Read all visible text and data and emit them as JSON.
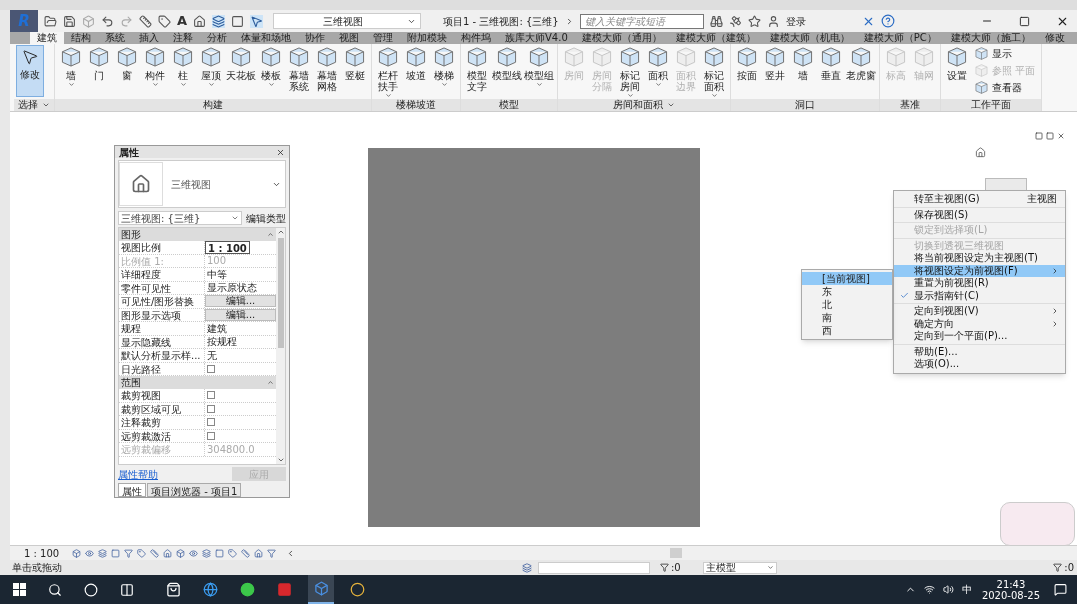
{
  "app": {
    "logo": "R",
    "text_tool": "A",
    "view_selector": "三维视图",
    "title": "项目1 - 三维视图: {三维}",
    "search": {
      "placeholder": "键入关键字或短语"
    },
    "sign_in": "登录"
  },
  "ribbon_tabs": [
    {
      "label": "建筑",
      "selected": true
    },
    {
      "label": "结构",
      "selected": false
    },
    {
      "label": "系统",
      "selected": false
    },
    {
      "label": "插入",
      "selected": false
    },
    {
      "label": "注释",
      "selected": false
    },
    {
      "label": "分析",
      "selected": false
    },
    {
      "label": "体量和场地",
      "selected": false
    },
    {
      "label": "协作",
      "selected": false
    },
    {
      "label": "视图",
      "selected": false
    },
    {
      "label": "管理",
      "selected": false
    },
    {
      "label": "附加模块",
      "selected": false
    },
    {
      "label": "构件坞",
      "selected": false
    },
    {
      "label": "族库大师V4.0",
      "selected": false
    },
    {
      "label": "建模大师（通用）",
      "selected": false
    },
    {
      "label": "建模大师（建筑）",
      "selected": false
    },
    {
      "label": "建模大师（机电）",
      "selected": false
    },
    {
      "label": "建模大师（PC）",
      "selected": false
    },
    {
      "label": "建模大师（施工）",
      "selected": false
    },
    {
      "label": "修改",
      "selected": false
    }
  ],
  "ribbon_panels": [
    {
      "title": "选择",
      "has_menu": true,
      "tools": [
        {
          "label": "修改",
          "kind": "large",
          "menu": false,
          "disabled": false,
          "selected": true
        }
      ]
    },
    {
      "title": "构建",
      "has_menu": false,
      "tools": [
        {
          "label": "墙",
          "kind": "large",
          "menu": true,
          "disabled": false,
          "selected": false
        },
        {
          "label": "门",
          "kind": "large",
          "menu": false,
          "disabled": false,
          "selected": false
        },
        {
          "label": "窗",
          "kind": "large",
          "menu": false,
          "disabled": false,
          "selected": false
        },
        {
          "label": "构件",
          "kind": "large",
          "menu": true,
          "disabled": false,
          "selected": false
        },
        {
          "label": "柱",
          "kind": "large",
          "menu": true,
          "disabled": false,
          "selected": false
        },
        {
          "label": "屋顶",
          "kind": "large",
          "menu": true,
          "disabled": false,
          "selected": false
        },
        {
          "label": "天花板",
          "kind": "large",
          "menu": false,
          "disabled": false,
          "selected": false
        },
        {
          "label": "楼板",
          "kind": "large",
          "menu": true,
          "disabled": false,
          "selected": false
        },
        {
          "label": "幕墙系统",
          "kind": "large",
          "menu": false,
          "disabled": false,
          "selected": false
        },
        {
          "label": "幕墙网格",
          "kind": "large",
          "menu": false,
          "disabled": false,
          "selected": false
        },
        {
          "label": "竖梃",
          "kind": "large",
          "menu": false,
          "disabled": false,
          "selected": false
        }
      ]
    },
    {
      "title": "楼梯坡道",
      "has_menu": false,
      "tools": [
        {
          "label": "栏杆扶手",
          "kind": "large",
          "menu": true,
          "disabled": false,
          "selected": false
        },
        {
          "label": "坡道",
          "kind": "large",
          "menu": false,
          "disabled": false,
          "selected": false
        },
        {
          "label": "楼梯",
          "kind": "large",
          "menu": true,
          "disabled": false,
          "selected": false
        }
      ]
    },
    {
      "title": "模型",
      "has_menu": false,
      "tools": [
        {
          "label": "模型文字",
          "kind": "large",
          "menu": false,
          "disabled": false,
          "selected": false
        },
        {
          "label": "模型线",
          "kind": "large",
          "menu": false,
          "disabled": false,
          "selected": false
        },
        {
          "label": "模型组",
          "kind": "large",
          "menu": true,
          "disabled": false,
          "selected": false
        }
      ]
    },
    {
      "title": "房间和面积",
      "has_menu": true,
      "tools": [
        {
          "label": "房间",
          "kind": "large",
          "menu": false,
          "disabled": true,
          "selected": false
        },
        {
          "label": "房间分隔",
          "kind": "large",
          "menu": false,
          "disabled": true,
          "selected": false
        },
        {
          "label": "标记房间",
          "kind": "large",
          "menu": true,
          "disabled": false,
          "selected": false
        },
        {
          "label": "面积",
          "kind": "large",
          "menu": true,
          "disabled": false,
          "selected": false
        },
        {
          "label": "面积边界",
          "kind": "large",
          "menu": false,
          "disabled": true,
          "selected": false
        },
        {
          "label": "标记面积",
          "kind": "large",
          "menu": true,
          "disabled": false,
          "selected": false
        }
      ]
    },
    {
      "title": "洞口",
      "has_menu": false,
      "tools": [
        {
          "label": "按面",
          "kind": "large",
          "menu": false,
          "disabled": false,
          "selected": false
        },
        {
          "label": "竖井",
          "kind": "large",
          "menu": false,
          "disabled": false,
          "selected": false
        },
        {
          "label": "墙",
          "kind": "large",
          "menu": false,
          "disabled": false,
          "selected": false
        },
        {
          "label": "垂直",
          "kind": "large",
          "menu": false,
          "disabled": false,
          "selected": false
        },
        {
          "label": "老虎窗",
          "kind": "large",
          "menu": false,
          "disabled": false,
          "selected": false
        }
      ]
    },
    {
      "title": "基准",
      "has_menu": false,
      "tools": [
        {
          "label": "标高",
          "kind": "large",
          "menu": false,
          "disabled": true,
          "selected": false
        },
        {
          "label": "轴网",
          "kind": "large",
          "menu": false,
          "disabled": true,
          "selected": false
        }
      ]
    },
    {
      "title": "工作平面",
      "has_menu": false,
      "tools": [
        {
          "label": "设置",
          "kind": "large",
          "menu": false,
          "disabled": false,
          "selected": false
        },
        {
          "label": "显示",
          "kind": "small",
          "menu": false,
          "disabled": false,
          "selected": false
        },
        {
          "label": "参照 平面",
          "kind": "small",
          "menu": false,
          "disabled": true,
          "selected": false
        },
        {
          "label": "查看器",
          "kind": "small",
          "menu": false,
          "disabled": false,
          "selected": false
        }
      ]
    }
  ],
  "properties": {
    "title": "属性",
    "type_name": "三维视图",
    "instance": "三维视图: {三维}",
    "edit_type": "编辑类型",
    "sections": [
      {
        "title": "图形",
        "rows": [
          {
            "name": "视图比例",
            "value": "1 : 100",
            "kind": "input",
            "disabled": false
          },
          {
            "name": "比例值 1:",
            "value": "100",
            "kind": "text",
            "disabled": true
          },
          {
            "name": "详细程度",
            "value": "中等",
            "kind": "text",
            "disabled": false
          },
          {
            "name": "零件可见性",
            "value": "显示原状态",
            "kind": "text",
            "disabled": false
          },
          {
            "name": "可见性/图形替换",
            "value": "编辑...",
            "kind": "button",
            "disabled": false
          },
          {
            "name": "图形显示选项",
            "value": "编辑...",
            "kind": "button",
            "disabled": false
          },
          {
            "name": "规程",
            "value": "建筑",
            "kind": "text",
            "disabled": false
          },
          {
            "name": "显示隐藏线",
            "value": "按规程",
            "kind": "text",
            "disabled": false
          },
          {
            "name": "默认分析显示样...",
            "value": "无",
            "kind": "text",
            "disabled": false
          },
          {
            "name": "日光路径",
            "kind": "checkbox",
            "checked": false,
            "disabled": false
          }
        ]
      },
      {
        "title": "范围",
        "rows": [
          {
            "name": "裁剪视图",
            "kind": "checkbox",
            "checked": false,
            "disabled": false
          },
          {
            "name": "裁剪区域可见",
            "kind": "checkbox",
            "checked": false,
            "disabled": false
          },
          {
            "name": "注释裁剪",
            "kind": "checkbox",
            "checked": false,
            "disabled": false
          },
          {
            "name": "远剪裁激活",
            "kind": "checkbox",
            "checked": false,
            "disabled": false
          },
          {
            "name": "远剪裁偏移",
            "value": "304800.0",
            "kind": "text",
            "disabled": true
          }
        ]
      }
    ],
    "help_link": "属性帮助",
    "apply": "应用",
    "tabs": [
      {
        "label": "属性",
        "selected": true
      },
      {
        "label": "项目浏览器 - 项目1",
        "selected": false
      }
    ]
  },
  "context_menu": {
    "groups": [
      [
        {
          "label": "转至主视图(G)",
          "shortcut": "主视图",
          "disabled": false,
          "checked": false,
          "selected": false,
          "submenu": false
        }
      ],
      [
        {
          "label": "保存视图(S)",
          "disabled": false,
          "checked": false,
          "selected": false,
          "submenu": false
        }
      ],
      [
        {
          "label": "锁定到选择项(L)",
          "disabled": true,
          "checked": false,
          "selected": false,
          "submenu": false
        }
      ],
      [
        {
          "label": "切换到透视三维视图",
          "disabled": true,
          "checked": false,
          "selected": false,
          "submenu": false
        },
        {
          "label": "将当前视图设定为主视图(T)",
          "disabled": false,
          "checked": false,
          "selected": false,
          "submenu": false
        },
        {
          "label": "将视图设定为前视图(F)",
          "disabled": false,
          "checked": false,
          "selected": true,
          "submenu": true
        },
        {
          "label": "重置为前视图(R)",
          "disabled": false,
          "checked": false,
          "selected": false,
          "submenu": false
        },
        {
          "label": "显示指南针(C)",
          "disabled": false,
          "checked": true,
          "selected": false,
          "submenu": false
        }
      ],
      [
        {
          "label": "定向到视图(V)",
          "disabled": false,
          "checked": false,
          "selected": false,
          "submenu": true
        },
        {
          "label": "确定方向",
          "disabled": false,
          "checked": false,
          "selected": false,
          "submenu": true
        },
        {
          "label": "定向到一个平面(P)...",
          "disabled": false,
          "checked": false,
          "selected": false,
          "submenu": false
        }
      ],
      [
        {
          "label": "帮助(E)...",
          "disabled": false,
          "checked": false,
          "selected": false,
          "submenu": false
        },
        {
          "label": "选项(O)...",
          "disabled": false,
          "checked": false,
          "selected": false,
          "submenu": false
        }
      ]
    ],
    "submenu": [
      {
        "label": "[当前视图]",
        "selected": true
      },
      {
        "label": "东",
        "selected": false
      },
      {
        "label": "北",
        "selected": false
      },
      {
        "label": "南",
        "selected": false
      },
      {
        "label": "西",
        "selected": false
      }
    ]
  },
  "status": {
    "scale": "1 : 100",
    "hint": "单击或拖动",
    "selection_count": ":0",
    "model": "主模型",
    "filter_count": ":0"
  },
  "taskbar": {
    "ime": "中",
    "time": "21:43",
    "date": "2020-08-25"
  }
}
